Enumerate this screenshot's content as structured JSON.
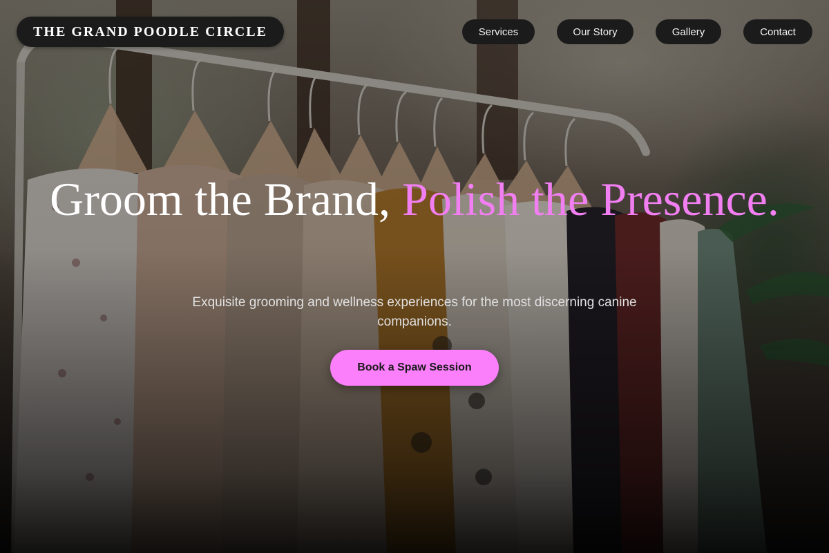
{
  "brand": {
    "name": "THE GRAND POODLE CIRCLE"
  },
  "nav": {
    "items": [
      {
        "label": "Services"
      },
      {
        "label": "Our Story"
      },
      {
        "label": "Gallery"
      },
      {
        "label": "Contact"
      }
    ]
  },
  "hero": {
    "headline_main": "Groom the Brand,",
    "headline_accent": "Polish the Presence.",
    "subtitle": "Exquisite grooming and wellness experiences for the most discerning canine companions.",
    "cta_label": "Book a Spaw Session",
    "background": "clothing-rack-photo"
  },
  "colors": {
    "accent": "#f27ff2",
    "button": "#fb7ffb",
    "pill_background": "#1b1b1b",
    "text_primary": "#ffffff"
  }
}
